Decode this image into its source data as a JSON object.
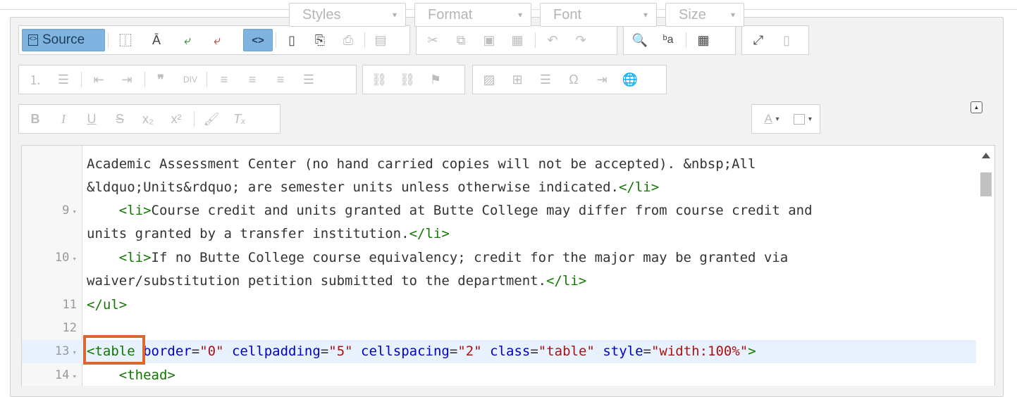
{
  "toolbar": {
    "source_label": "Source",
    "combos": {
      "styles": "Styles",
      "format": "Format",
      "font": "Font",
      "size": "Size"
    }
  },
  "editor": {
    "lines": [
      {
        "num": "",
        "fold": false,
        "text": "Academic Assessment Center (no hand carried copies will not be accepted). &nbsp;All"
      },
      {
        "num": "",
        "fold": false,
        "text": "&ldquo;Units&rdquo; are semester units unless otherwise indicated.",
        "tail": "</li>"
      },
      {
        "num": "9",
        "fold": true,
        "indent": "    ",
        "tag": "<li>",
        "text": "Course credit and units granted at Butte College may differ from course credit and"
      },
      {
        "num": "",
        "fold": false,
        "text": "units granted by a transfer institution.",
        "tail": "</li>"
      },
      {
        "num": "10",
        "fold": true,
        "indent": "    ",
        "tag": "<li>",
        "text": "If no Butte College course equivalency; credit for the major may be granted via"
      },
      {
        "num": "",
        "fold": false,
        "text": "waiver/substitution petition submitted to the department.",
        "tail": "</li>"
      },
      {
        "num": "11",
        "fold": false,
        "tag": "</ul>",
        "text": ""
      },
      {
        "num": "12",
        "fold": false,
        "text": ""
      },
      {
        "num": "13",
        "fold": true,
        "active": true,
        "tag": "<table",
        "attrs": [
          {
            "name": "border",
            "value": "\"0\""
          },
          {
            "name": "cellpadding",
            "value": "\"5\""
          },
          {
            "name": "cellspacing",
            "value": "\"2\""
          },
          {
            "name": "class",
            "value": "\"table\""
          },
          {
            "name": "style",
            "value": "\"width:100%\""
          }
        ],
        "close": ">"
      },
      {
        "num": "14",
        "fold": true,
        "indent": "    ",
        "tag": "<thead>",
        "text": ""
      }
    ]
  }
}
